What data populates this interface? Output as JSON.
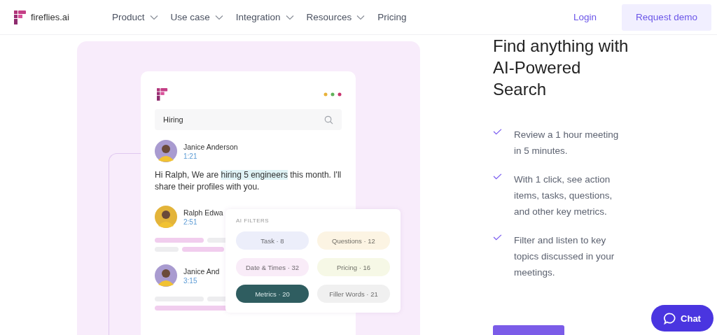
{
  "nav": {
    "brand": "fireflies.ai",
    "items": [
      {
        "label": "Product",
        "dropdown": true
      },
      {
        "label": "Use case",
        "dropdown": true
      },
      {
        "label": "Integration",
        "dropdown": true
      },
      {
        "label": "Resources",
        "dropdown": true
      },
      {
        "label": "Pricing",
        "dropdown": false
      }
    ],
    "login": "Login",
    "cta": "Request demo"
  },
  "demo": {
    "search": {
      "value": "Hiring"
    },
    "messages": [
      {
        "name": "Janice Anderson",
        "time": "1:21",
        "color": "#a99bd0",
        "text_before": "Hi Ralph, We are ",
        "highlight": "hiring 5 engineers",
        "text_after": " this month. I'll share their profiles with you."
      },
      {
        "name": "Ralph Edwa",
        "time": "2:51",
        "color": "#e3b43a"
      },
      {
        "name": "Janice And",
        "time": "3:15",
        "color": "#a99bd0"
      }
    ],
    "filters": {
      "title": "AI FILTERS",
      "chips": [
        {
          "label": "Task · 8",
          "color": "#eceefa",
          "selected": false
        },
        {
          "label": "Questions · 12",
          "color": "#fcf4e3",
          "selected": false
        },
        {
          "label": "Date & Times · 32",
          "color": "#f9ecf8",
          "selected": false
        },
        {
          "label": "Pricing · 16",
          "color": "#f6f8e6",
          "selected": false
        },
        {
          "label": "Metrics · 20",
          "color": "#2f5d60",
          "selected": true
        },
        {
          "label": "Filler Words · 21",
          "color": "#f0f0f0",
          "selected": false
        }
      ]
    }
  },
  "heading": "Find anything with AI-Powered Search",
  "features": [
    "Review a 1 hour meeting in 5 minutes.",
    "With 1 click, see action items, tasks, questions, and other key metrics.",
    "Filter and listen to key topics discussed in your meetings."
  ],
  "chat": "Chat"
}
